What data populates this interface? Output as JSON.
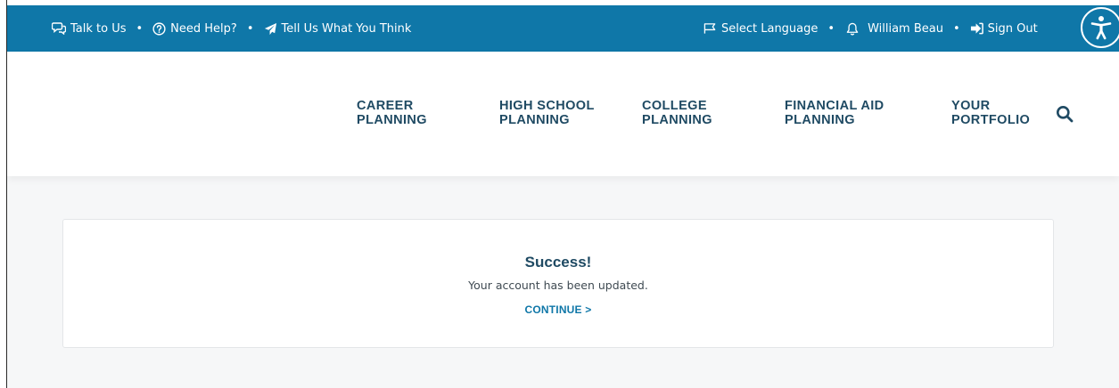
{
  "utility_bar": {
    "left_items": [
      {
        "label": "Talk to Us",
        "icon": "chat-icon"
      },
      {
        "label": "Need Help?",
        "icon": "help-circle-icon"
      },
      {
        "label": "Tell Us What You Think",
        "icon": "paper-plane-icon"
      }
    ],
    "right_items": [
      {
        "label": "Select Language",
        "icon": "flag-icon"
      },
      {
        "label": "William Beau",
        "icon": "bell-icon"
      },
      {
        "label": "Sign Out",
        "icon": "sign-out-icon"
      }
    ],
    "separator": "•",
    "accessibility_icon": "accessibility-icon"
  },
  "nav": {
    "items": [
      {
        "label": "CAREER\nPLANNING"
      },
      {
        "label": "HIGH SCHOOL\nPLANNING"
      },
      {
        "label": "COLLEGE\nPLANNING"
      },
      {
        "label": "FINANCIAL AID\nPLANNING"
      },
      {
        "label": "YOUR\nPORTFOLIO"
      }
    ],
    "search_icon": "search-icon"
  },
  "card": {
    "title": "Success!",
    "message": "Your account has been updated.",
    "link_label": "CONTINUE >"
  },
  "colors": {
    "utility_bar_bg": "#0f77a8",
    "nav_text": "#1f4a63",
    "link": "#0f77a8",
    "page_bg": "#f6f7f8"
  }
}
